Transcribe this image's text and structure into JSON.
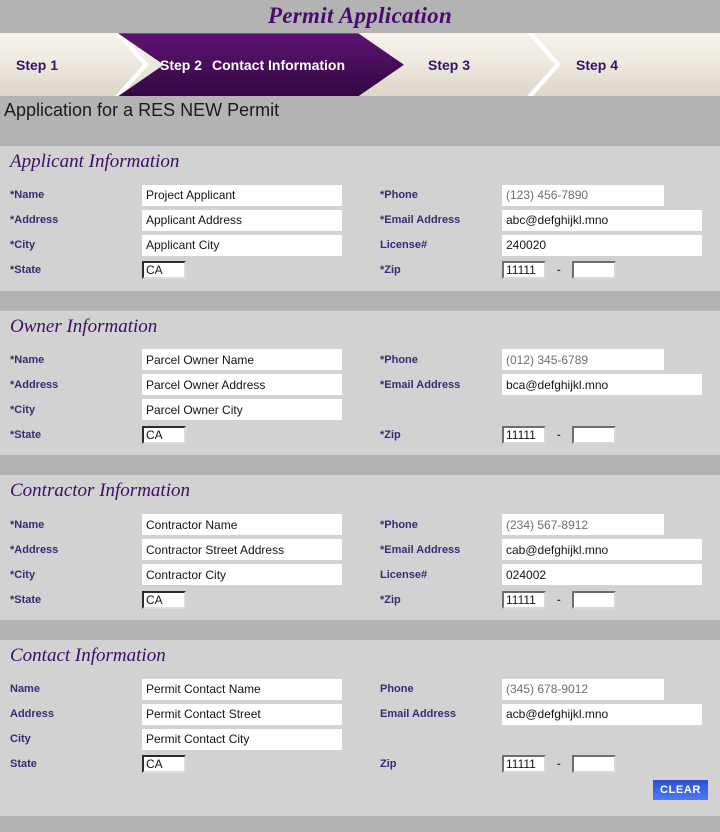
{
  "page": {
    "title": "Permit Application",
    "subtitle": "Application for a RES NEW Permit"
  },
  "steps": [
    {
      "num": "Step 1",
      "name": "",
      "active": false
    },
    {
      "num": "Step 2",
      "name": "Contact Information",
      "active": true
    },
    {
      "num": "Step 3",
      "name": "",
      "active": false
    },
    {
      "num": "Step 4",
      "name": "",
      "active": false
    }
  ],
  "sections": {
    "applicant": {
      "title": "Applicant Information",
      "labels": {
        "name": "*Name",
        "address": "*Address",
        "city": "*City",
        "state": "*State",
        "phone": "*Phone",
        "email": "*Email Address",
        "license": "License#",
        "zip": "*Zip",
        "zip_dash": "-"
      },
      "values": {
        "name": "Project Applicant",
        "address": "Applicant Address",
        "city": "Applicant City",
        "state": "CA",
        "phone": "(123) 456-7890",
        "email": "abc@defghijkl.mno",
        "license": "240020",
        "zip1": "11111",
        "zip2": ""
      }
    },
    "owner": {
      "title": "Owner Information",
      "labels": {
        "name": "*Name",
        "address": "*Address",
        "city": "*City",
        "state": "*State",
        "phone": "*Phone",
        "email": "*Email Address",
        "zip": "*Zip",
        "zip_dash": "-"
      },
      "values": {
        "name": "Parcel Owner Name",
        "address": "Parcel Owner Address",
        "city": "Parcel Owner City",
        "state": "CA",
        "phone": "(012) 345-6789",
        "email": "bca@defghijkl.mno",
        "zip1": "11111",
        "zip2": ""
      }
    },
    "contractor": {
      "title": "Contractor Information",
      "labels": {
        "name": "*Name",
        "address": "*Address",
        "city": "*City",
        "state": "*State",
        "phone": "*Phone",
        "email": "*Email Address",
        "license": "License#",
        "zip": "*Zip",
        "zip_dash": "-"
      },
      "values": {
        "name": "Contractor Name",
        "address": "Contractor Street Address",
        "city": "Contractor City",
        "state": "CA",
        "phone": "(234) 567-8912",
        "email": "cab@defghijkl.mno",
        "license": "024002",
        "zip1": "11111",
        "zip2": ""
      }
    },
    "contact": {
      "title": "Contact Information",
      "labels": {
        "name": "Name",
        "address": "Address",
        "city": "City",
        "state": "State",
        "phone": "Phone",
        "email": "Email Address",
        "zip": "Zip",
        "zip_dash": "-"
      },
      "values": {
        "name": "Permit Contact Name",
        "address": "Permit Contact Street",
        "city": "Permit Contact City",
        "state": "CA",
        "phone": "(345) 678-9012",
        "email": "acb@defghijkl.mno",
        "zip1": "11111",
        "zip2": ""
      }
    }
  },
  "buttons": {
    "clear": "CLEAR"
  },
  "colors": {
    "brand_purple": "#4b0a6e",
    "active_step": "#4d0f5f",
    "label_purple": "#3b2a72",
    "page_bg": "#b3b3b3",
    "panel_bg": "#d2d2d2",
    "clear_blue": "#3a63e2"
  }
}
